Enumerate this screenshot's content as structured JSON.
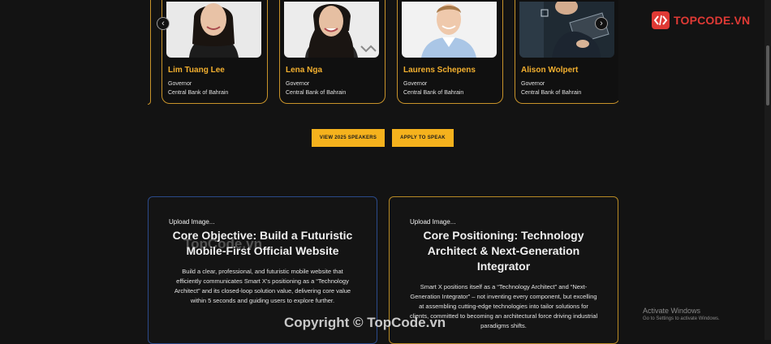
{
  "speakers": [
    {
      "name": "Lim Tuang Lee",
      "role": "Governor",
      "org": "Central Bank of Bahrain"
    },
    {
      "name": "Lena Nga",
      "role": "Governor",
      "org": "Central Bank of Bahrain"
    },
    {
      "name": "Laurens Schepens",
      "role": "Governor",
      "org": "Central Bank of Bahrain"
    },
    {
      "name": "Alison Wolpert",
      "role": "Governor",
      "org": "Central Bank of Bahrain"
    }
  ],
  "carousel": {
    "prev_icon": "‹",
    "next_icon": "›"
  },
  "buttons": {
    "view_speakers": "VIEW 2025 SPEAKERS",
    "apply_speak": "APPLY TO SPEAK"
  },
  "panels": [
    {
      "upload": "Upload Image...",
      "title": "Core Objective: Build a Futuristic Mobile-First Official Website",
      "text": "Build a clear, professional, and futuristic mobile website that efficiently communicates Smart X's positioning as a “Technology Architect” and its closed-loop solution value, delivering core value within 5 seconds and guiding users to explore further."
    },
    {
      "upload": "Upload Image...",
      "title": "Core Positioning: Technology Architect & Next-Generation Integrator",
      "text": "Smart X positions itself as a “Technology Architect” and “Next-Generation Integrator” – not inventing every component, but excelling at assembling cutting-edge technologies into tailor solutions for clients, committed to becoming an architectural force driving industrial paradigms shifts."
    }
  ],
  "logo": {
    "text": "TOPCODE.VN",
    "icon": "topcode-logo-icon"
  },
  "watermarks": {
    "center": "TopCode.vn",
    "bottom": "Copyright © TopCode.vn"
  },
  "activate_windows": {
    "title": "Activate Windows",
    "subtitle": "Go to Settings to activate Windows."
  },
  "colors": {
    "accent": "#f5b21d",
    "card_border": "#c8932a",
    "panel_left_border": "#2b4a8a",
    "panel_right_border": "#b88a25",
    "background": "#131313"
  }
}
